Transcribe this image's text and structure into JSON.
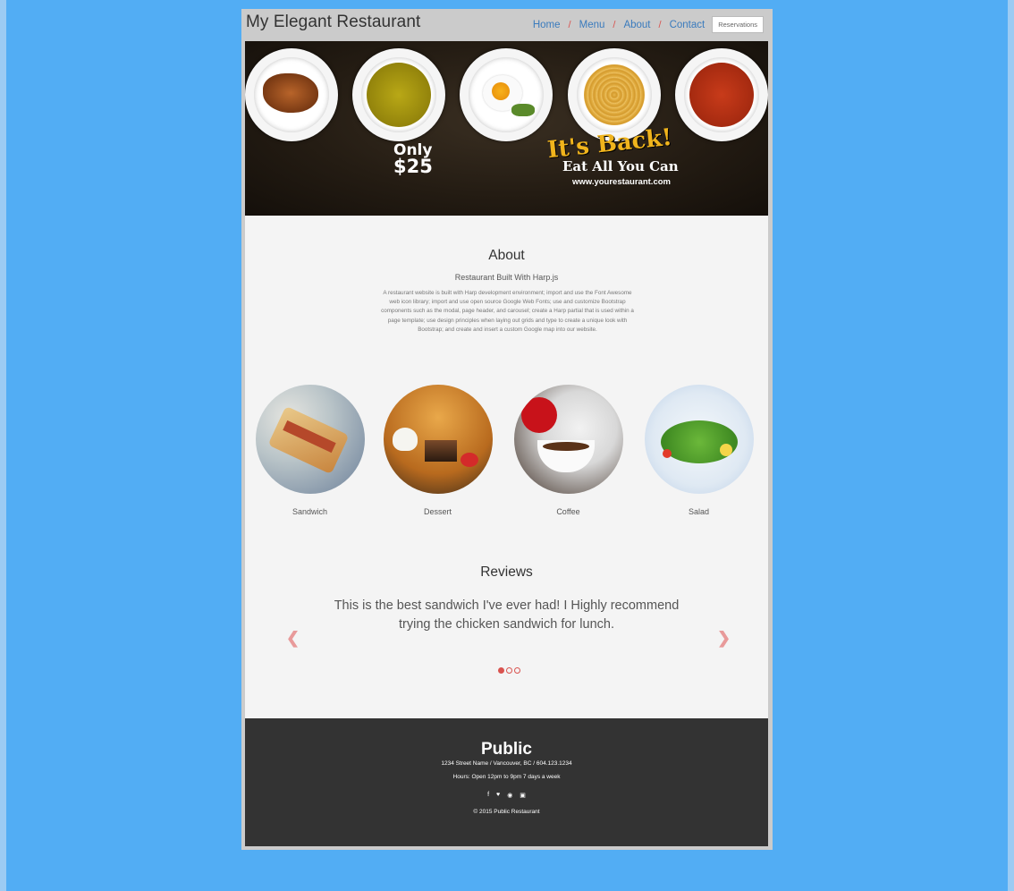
{
  "window": {
    "background_color": "#52adf4"
  },
  "navbar": {
    "brand": "My Elegant Restaurant",
    "links": [
      "Home",
      "Menu",
      "About",
      "Contact"
    ],
    "separator": "/",
    "reservations_label": "Reservations",
    "link_color": "#3a7bbd",
    "separator_color": "#d9534f"
  },
  "hero": {
    "only_text": "Only",
    "price_text": "$25",
    "headline": "It's Back!",
    "tagline": "Eat All You Can",
    "url": "www.yourestaurant.com"
  },
  "about": {
    "title": "About",
    "subtitle": "Restaurant Built With Harp.js",
    "body": "A restaurant website is built with Harp development environment; import and use the Font Awesome web icon library; import and use open source Google Web Fonts; use and customize Bootstrap components such as the modal, page header, and carousel; create a Harp partial that is used within a page template; use design principles when laying out grids and type to create a unique look with Bootstrap; and create and insert a custom Google map into our website."
  },
  "dishes": [
    {
      "label": "Sandwich",
      "icon": "sandwich-photo"
    },
    {
      "label": "Dessert",
      "icon": "dessert-photo"
    },
    {
      "label": "Coffee",
      "icon": "coffee-photo"
    },
    {
      "label": "Salad",
      "icon": "salad-photo"
    }
  ],
  "reviews": {
    "title": "Reviews",
    "quote": "This is the best sandwich I've ever had! I Highly recommend trying the chicken sandwich for lunch.",
    "prev_icon": "chevron-left-icon",
    "next_icon": "chevron-right-icon",
    "slide_count": 3,
    "active_slide": 1
  },
  "footer": {
    "name": "Public",
    "address": "1234 Street Name / Vancouver, BC / 604.123.1234",
    "hours": "Hours: Open 12pm to 9pm 7 days a week",
    "social_icons": [
      "facebook-icon",
      "twitter-icon",
      "pinterest-icon",
      "instagram-icon"
    ],
    "copyright": "© 2015 Public Restaurant"
  }
}
